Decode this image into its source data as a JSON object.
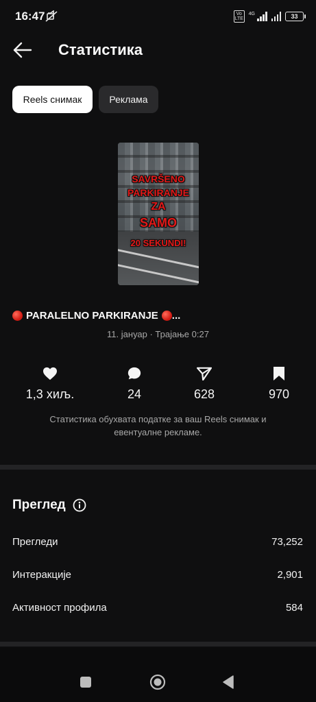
{
  "status_bar": {
    "time": "16:47",
    "network": "4G",
    "volte": "Vo LTE",
    "battery": "33",
    "icons": [
      "mute-icon",
      "volte-icon",
      "signal-icon",
      "signal-icon",
      "battery-icon"
    ]
  },
  "header": {
    "title": "Статистика"
  },
  "tabs": [
    {
      "label": "Reels снимак",
      "active": true
    },
    {
      "label": "Реклама",
      "active": false
    }
  ],
  "reel": {
    "thumbnail_text": [
      "SAVRŠENO",
      "PARKIRANJE",
      "ZA",
      "SAMO",
      "20 SEKUNDI!"
    ],
    "title": "PARALELNO PARKIRANJE",
    "title_suffix": "...",
    "meta": "11. јануар · Трајање 0:27"
  },
  "stats": [
    {
      "icon": "heart-icon",
      "value": "1,3 хиљ."
    },
    {
      "icon": "comment-icon",
      "value": "24"
    },
    {
      "icon": "share-icon",
      "value": "628"
    },
    {
      "icon": "bookmark-icon",
      "value": "970"
    }
  ],
  "note": "Статистика обухвата податке за ваш Reels снимак и евентуалне рекламе.",
  "overview": {
    "title": "Преглед",
    "rows": [
      {
        "label": "Прегледи",
        "value": "73,252"
      },
      {
        "label": "Интеракције",
        "value": "2,901"
      },
      {
        "label": "Активност профила",
        "value": "584"
      }
    ]
  },
  "colors": {
    "background": "#0f0f10",
    "chip_active": "#ffffff",
    "chip_inactive": "#2a2a2c",
    "accent_red": "#e21818"
  }
}
